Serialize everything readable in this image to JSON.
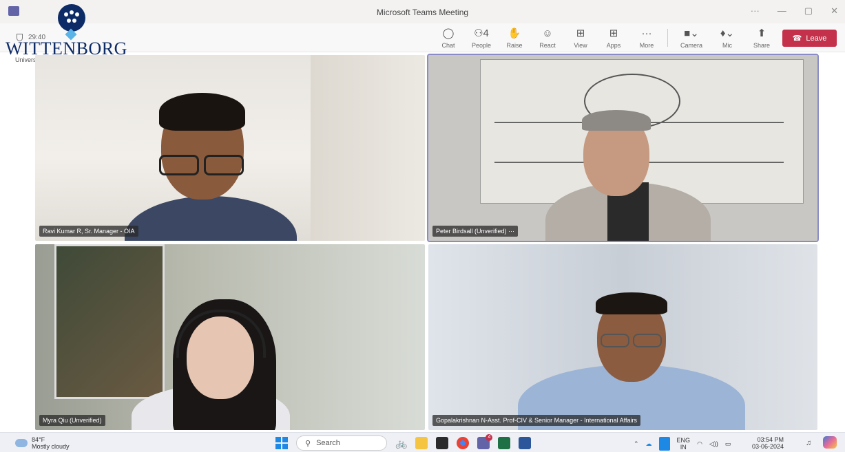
{
  "window": {
    "title": "Microsoft Teams Meeting",
    "controls": [
      "···",
      "—",
      "▢",
      "✕"
    ]
  },
  "meeting": {
    "timer": "29:40"
  },
  "toolbar": {
    "tools": [
      {
        "label": "Chat",
        "icon": "chat-icon",
        "glyph": "◯"
      },
      {
        "label": "People",
        "icon": "people-icon",
        "glyph": "⚇4"
      },
      {
        "label": "Raise",
        "icon": "raise-hand-icon",
        "glyph": "✋"
      },
      {
        "label": "React",
        "icon": "react-icon",
        "glyph": "☺"
      },
      {
        "label": "View",
        "icon": "view-icon",
        "glyph": "⊞"
      },
      {
        "label": "Apps",
        "icon": "apps-icon",
        "glyph": "⊞"
      },
      {
        "label": "More",
        "icon": "more-icon",
        "glyph": "···"
      }
    ],
    "devices": [
      {
        "label": "Camera",
        "icon": "camera-icon",
        "glyph": "■⌄"
      },
      {
        "label": "Mic",
        "icon": "mic-icon",
        "glyph": "♦⌄"
      },
      {
        "label": "Share",
        "icon": "share-icon",
        "glyph": "⬆"
      }
    ],
    "leave_label": "Leave",
    "leave_color": "#c4314b"
  },
  "logo": {
    "name": "WITTENBORG",
    "subtitle": "University of Applied Sciences"
  },
  "participants": [
    {
      "name": "Ravi Kumar R, Sr. Manager - OIA"
    },
    {
      "name": "Peter Birdsall (Unverified)  ···"
    },
    {
      "name": "Myra Qiu (Unverified)"
    },
    {
      "name": "Gopalakrishnan N-Asst. Prof-CIV & Senior Manager - International Affairs"
    }
  ],
  "taskbar": {
    "weather_temp": "84°F",
    "weather_desc": "Mostly cloudy",
    "search_label": "Search",
    "lang": "ENG",
    "region": "IN",
    "time": "03:54 PM",
    "date": "03-06-2024",
    "teams_badge": "4"
  }
}
